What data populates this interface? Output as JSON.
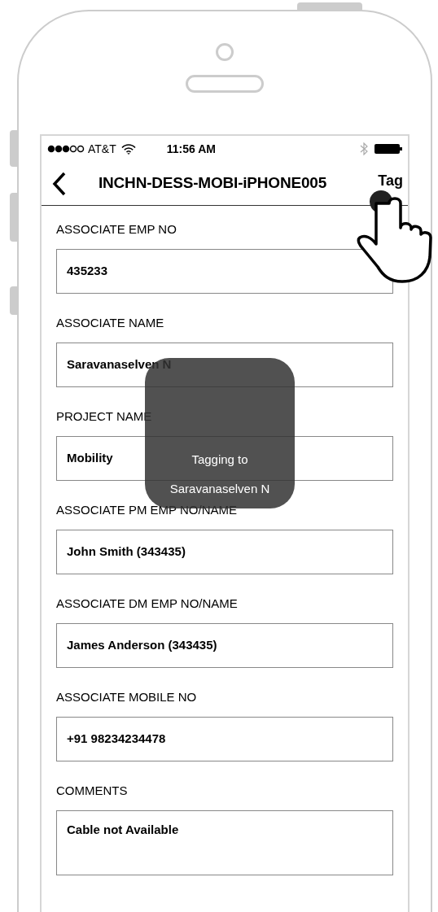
{
  "status_bar": {
    "carrier": "AT&T",
    "time": "11:56 AM"
  },
  "nav_bar": {
    "title": "INCHN-DESS-MOBI-iPHONE005",
    "action": "Tag"
  },
  "fields": [
    {
      "kind": "text",
      "label": "ASSOCIATE EMP NO",
      "value": "435233"
    },
    {
      "kind": "text",
      "label": "ASSOCIATE NAME",
      "value": "Saravanaselven N"
    },
    {
      "kind": "text",
      "label": "PROJECT NAME",
      "value": "Mobility"
    },
    {
      "kind": "text",
      "label": "ASSOCIATE PM EMP NO/NAME",
      "value": "John Smith (343435)"
    },
    {
      "kind": "text",
      "label": "ASSOCIATE DM EMP NO/NAME",
      "value": "James Anderson (343435)"
    },
    {
      "kind": "text",
      "label": "ASSOCIATE MOBILE NO",
      "value": "+91 98234234478"
    },
    {
      "kind": "multiline",
      "label": "COMMENTS",
      "value": "Cable not Available"
    }
  ],
  "toast": {
    "lines": [
      "Tagging to",
      "Saravanaselven N"
    ]
  }
}
